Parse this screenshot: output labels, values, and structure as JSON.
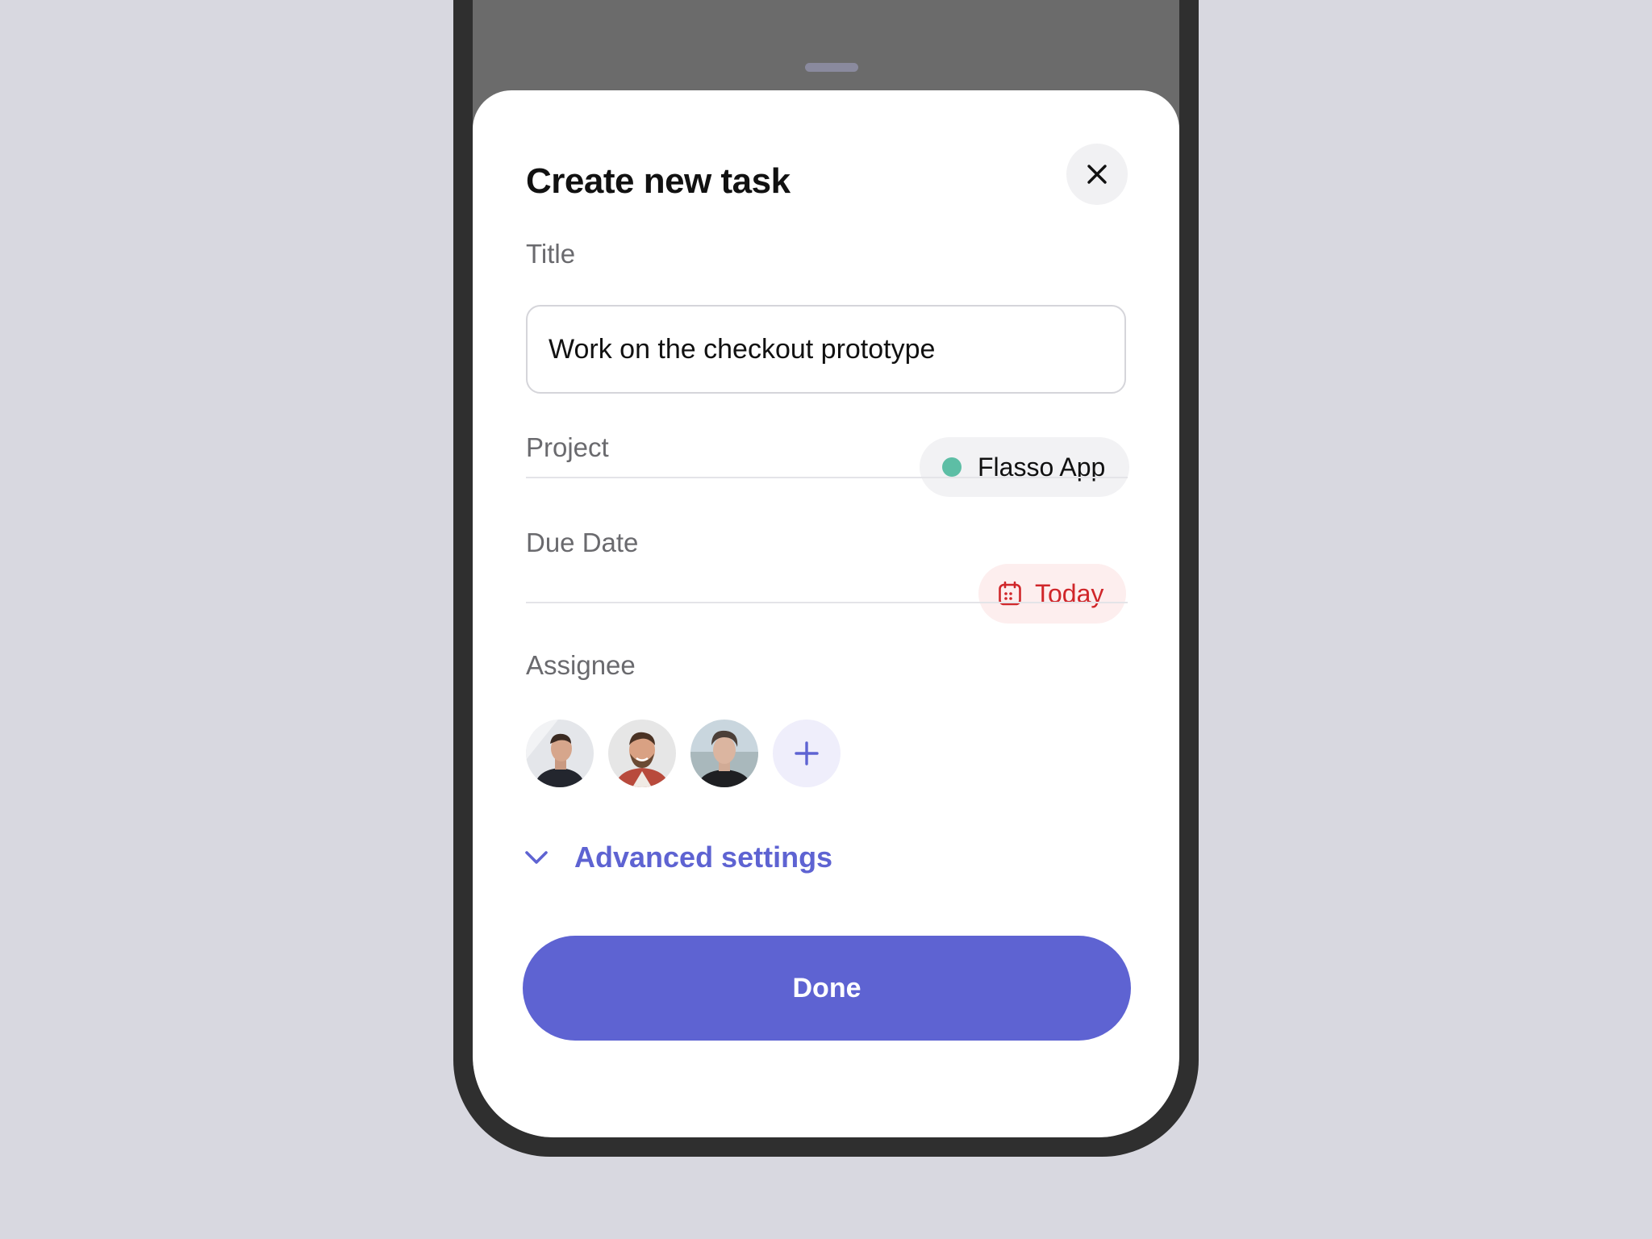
{
  "sheet": {
    "title": "Create new task"
  },
  "form": {
    "title_label": "Title",
    "title_value": "Work on the checkout prototype",
    "project_label": "Project",
    "project_value": "Flasso App",
    "due_date_label": "Due Date",
    "due_date_value": "Today",
    "assignee_label": "Assignee",
    "advanced_label": "Advanced settings",
    "done_label": "Done"
  },
  "colors": {
    "accent": "#5e63d2",
    "project_dot": "#5dbea5",
    "due_date": "#d0262a",
    "background": "#d8d8e0"
  },
  "icons": {
    "close": "close-icon",
    "calendar": "calendar-icon",
    "add": "plus-icon",
    "expand": "chevron-down-icon"
  }
}
